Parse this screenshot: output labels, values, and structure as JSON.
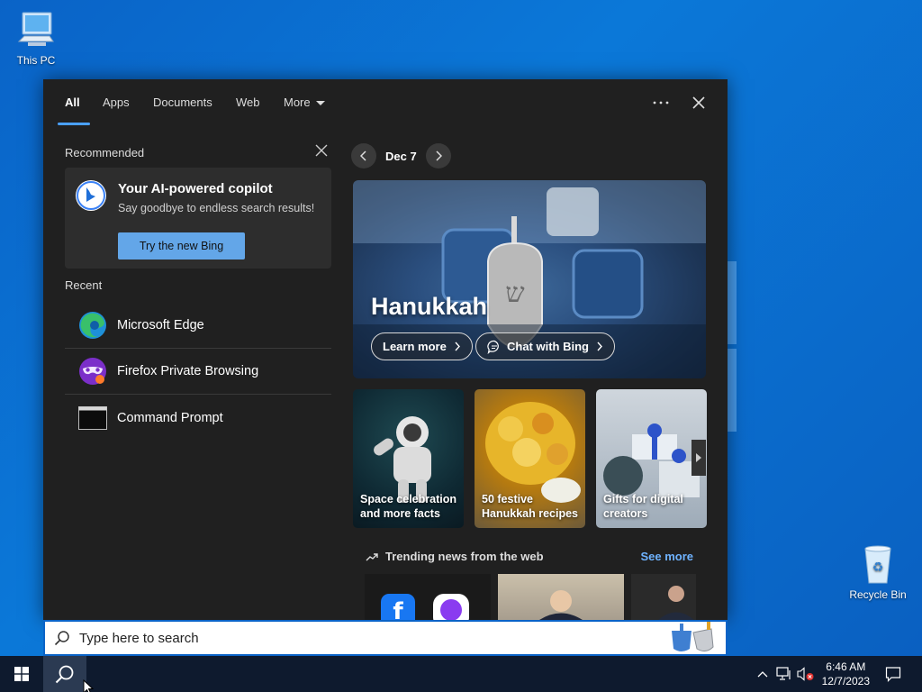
{
  "desktop": {
    "this_pc_label": "This PC",
    "recycle_bin_label": "Recycle Bin"
  },
  "tabs": [
    {
      "label": "All",
      "active": true
    },
    {
      "label": "Apps"
    },
    {
      "label": "Documents"
    },
    {
      "label": "Web"
    },
    {
      "label": "More"
    }
  ],
  "recommended": {
    "title": "Recommended",
    "card_title": "Your AI-powered copilot",
    "card_subtitle": "Say goodbye to endless search results!",
    "button_label": "Try the new Bing"
  },
  "recent": {
    "title": "Recent",
    "items": [
      {
        "label": "Microsoft Edge",
        "icon": "edge-icon"
      },
      {
        "label": "Firefox Private Browsing",
        "icon": "firefox-private-icon"
      },
      {
        "label": "Command Prompt",
        "icon": "cmd-icon"
      }
    ]
  },
  "highlights": {
    "date": "Dec 7",
    "hero_title": "Hanukkah",
    "learn_more": "Learn more",
    "chat_with_bing": "Chat with Bing",
    "cards": [
      {
        "caption": "Space celebration and more facts"
      },
      {
        "caption": "50 festive Hanukkah recipes"
      },
      {
        "caption": "Gifts for digital creators"
      }
    ],
    "trending_title": "Trending news from the web",
    "see_more": "See more"
  },
  "search": {
    "placeholder": "Type here to search"
  },
  "taskbar": {
    "time": "6:46 AM",
    "date": "12/7/2023"
  },
  "colors": {
    "accent": "#4aa0ff",
    "bing_button": "#63a6e8",
    "panel_bg": "#202020"
  }
}
